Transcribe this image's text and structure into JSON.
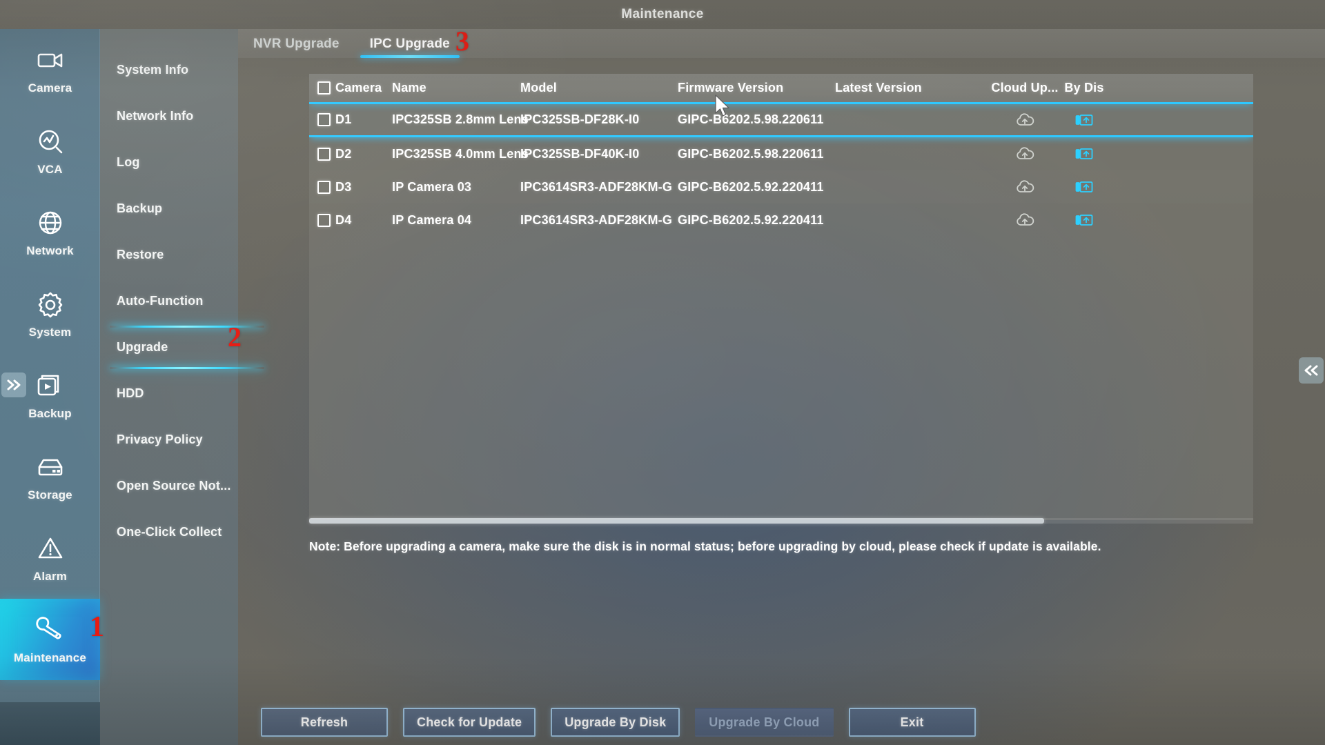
{
  "window": {
    "title": "Maintenance"
  },
  "rail": {
    "items": [
      {
        "label": "Camera",
        "icon": "camera-icon",
        "active": false
      },
      {
        "label": "VCA",
        "icon": "vca-icon",
        "active": false
      },
      {
        "label": "Network",
        "icon": "globe-icon",
        "active": false
      },
      {
        "label": "System",
        "icon": "gear-icon",
        "active": false
      },
      {
        "label": "Backup",
        "icon": "backup-icon",
        "active": false
      },
      {
        "label": "Storage",
        "icon": "storage-icon",
        "active": false
      },
      {
        "label": "Alarm",
        "icon": "alarm-icon",
        "active": false
      },
      {
        "label": "Maintenance",
        "icon": "wrench-icon",
        "active": true
      }
    ],
    "collapse_icon": "chevron-double-right-icon"
  },
  "submenu": {
    "items": [
      {
        "label": "System Info",
        "active": false
      },
      {
        "label": "Network Info",
        "active": false
      },
      {
        "label": "Log",
        "active": false
      },
      {
        "label": "Backup",
        "active": false
      },
      {
        "label": "Restore",
        "active": false
      },
      {
        "label": "Auto-Function",
        "active": false
      },
      {
        "label": "Upgrade",
        "active": true
      },
      {
        "label": "HDD",
        "active": false
      },
      {
        "label": "Privacy Policy",
        "active": false
      },
      {
        "label": "Open Source Not...",
        "active": false
      },
      {
        "label": "One-Click Collect",
        "active": false
      }
    ]
  },
  "tabs": [
    {
      "label": "NVR Upgrade",
      "active": false
    },
    {
      "label": "IPC Upgrade",
      "active": true
    }
  ],
  "table": {
    "columns": [
      "Camera",
      "Name",
      "Model",
      "Firmware Version",
      "Latest Version",
      "Cloud Up...",
      "By Dis"
    ],
    "rows": [
      {
        "camera": "D1",
        "name": "IPC325SB 2.8mm Lens",
        "model": "IPC325SB-DF28K-I0",
        "firmware": "GIPC-B6202.5.98.220611",
        "latest": "",
        "cloud_icon": "cloud-upload-icon",
        "disk_icon": "disk-upload-icon",
        "selected": true,
        "checked": false
      },
      {
        "camera": "D2",
        "name": "IPC325SB 4.0mm Lens",
        "model": "IPC325SB-DF40K-I0",
        "firmware": "GIPC-B6202.5.98.220611",
        "latest": "",
        "cloud_icon": "cloud-upload-icon",
        "disk_icon": "disk-upload-icon",
        "selected": false,
        "checked": false
      },
      {
        "camera": "D3",
        "name": "IP Camera 03",
        "model": "IPC3614SR3-ADF28KM-G",
        "firmware": "GIPC-B6202.5.92.220411",
        "latest": "",
        "cloud_icon": "cloud-upload-icon",
        "disk_icon": "disk-upload-icon",
        "selected": false,
        "checked": false
      },
      {
        "camera": "D4",
        "name": "IP Camera 04",
        "model": "IPC3614SR3-ADF28KM-G",
        "firmware": "GIPC-B6202.5.92.220411",
        "latest": "",
        "cloud_icon": "cloud-upload-icon",
        "disk_icon": "disk-upload-icon",
        "selected": false,
        "checked": false
      }
    ],
    "select_all_checked": false
  },
  "note": "Note: Before upgrading a camera, make sure the disk is in normal status; before upgrading by cloud, please check if update is available.",
  "buttons": [
    {
      "label": "Refresh",
      "disabled": false
    },
    {
      "label": "Check for Update",
      "disabled": false
    },
    {
      "label": "Upgrade By Disk",
      "disabled": false
    },
    {
      "label": "Upgrade By Cloud",
      "disabled": true
    },
    {
      "label": "Exit",
      "disabled": false
    }
  ],
  "annotations": [
    {
      "id": "1",
      "text": "1"
    },
    {
      "id": "2",
      "text": "2"
    },
    {
      "id": "3",
      "text": "3"
    }
  ],
  "right_collapse_icon": "chevron-double-left-icon",
  "colors": {
    "accent_cyan": "#2ec8ff",
    "active_gradient_start": "#1fd8e8",
    "active_gradient_end": "#2f6fc4",
    "annotation_red": "#e81b12",
    "text_white": "#ffffff"
  }
}
